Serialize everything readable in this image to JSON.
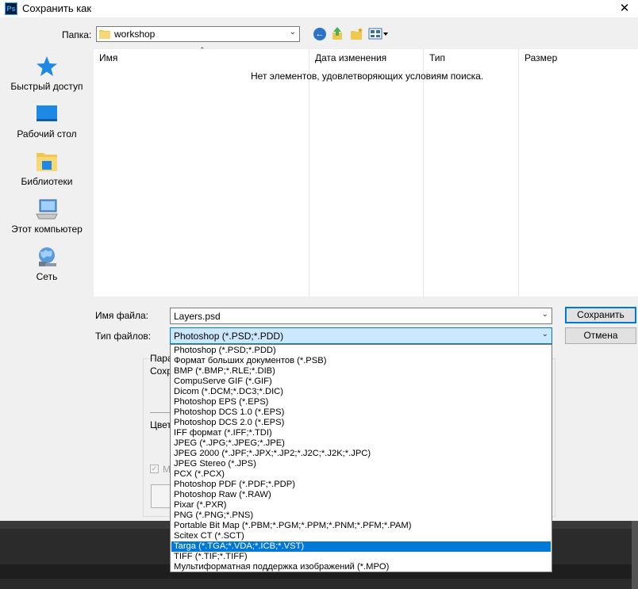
{
  "window": {
    "title": "Сохранить как",
    "app_icon": "Ps",
    "close_glyph": "✕"
  },
  "toolbar": {
    "folder_label": "Папка:",
    "folder_value": "workshop",
    "back_glyph": "←"
  },
  "sidebar": {
    "items": [
      {
        "label": "Быстрый доступ",
        "icon": "star-icon"
      },
      {
        "label": "Рабочий стол",
        "icon": "desktop-icon"
      },
      {
        "label": "Библиотеки",
        "icon": "libraries-icon"
      },
      {
        "label": "Этот компьютер",
        "icon": "computer-icon"
      },
      {
        "label": "Сеть",
        "icon": "network-icon"
      }
    ]
  },
  "filelist": {
    "columns": [
      "Имя",
      "Дата изменения",
      "Тип",
      "Размер"
    ],
    "empty_message": "Нет элементов, удовлетворяющих условиям поиска."
  },
  "form": {
    "filename_label": "Имя файла:",
    "filename_value": "Layers.psd",
    "filetype_label": "Тип файлов:",
    "filetype_value": "Photoshop (*.PSD;*.PDD)",
    "save_label": "Сохранить",
    "cancel_label": "Отмена"
  },
  "options": {
    "params_label": "Пара",
    "save_label": "Сохр",
    "color_label": "Цвет",
    "check_label": "М"
  },
  "dropdown": {
    "selected_index": 19,
    "items": [
      "Photoshop (*.PSD;*.PDD)",
      "Формат больших документов (*.PSB)",
      "BMP (*.BMP;*.RLE;*.DIB)",
      "CompuServe GIF (*.GIF)",
      "Dicom (*.DCM;*.DC3;*.DIC)",
      "Photoshop EPS (*.EPS)",
      "Photoshop DCS 1.0 (*.EPS)",
      "Photoshop DCS 2.0 (*.EPS)",
      "IFF формат (*.IFF;*.TDI)",
      "JPEG (*.JPG;*.JPEG;*.JPE)",
      "JPEG 2000 (*.JPF;*.JPX;*.JP2;*.J2C;*.J2K;*.JPC)",
      "JPEG Stereo (*.JPS)",
      "PCX (*.PCX)",
      "Photoshop PDF (*.PDF;*.PDP)",
      "Photoshop Raw (*.RAW)",
      "Pixar (*.PXR)",
      "PNG (*.PNG;*.PNS)",
      "Portable Bit Map (*.PBM;*.PGM;*.PPM;*.PNM;*.PFM;*.PAM)",
      "Scitex CT (*.SCT)",
      "Targa (*.TGA;*.VDA;*.ICB;*.VST)",
      "TIFF (*.TIF;*.TIFF)",
      "Мультиформатная поддержка изображений  (*.MPO)"
    ]
  },
  "colors": {
    "accent": "#0078d7",
    "selection": "#0078d7",
    "combo_focus_bg": "#cce8ff"
  }
}
